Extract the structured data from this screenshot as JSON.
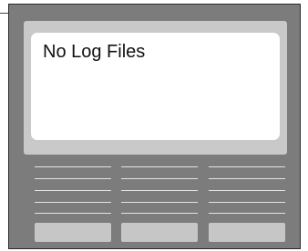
{
  "screen": {
    "message": "No Log Files"
  },
  "colors": {
    "device_body": "#7c7c7c",
    "screen_bezel": "#c9c9c9",
    "screen_background": "#ffffff",
    "lines": "#e4e4e4",
    "buttons": "#c6c6c6"
  },
  "softkeys": [
    {
      "label": ""
    },
    {
      "label": ""
    },
    {
      "label": ""
    }
  ]
}
